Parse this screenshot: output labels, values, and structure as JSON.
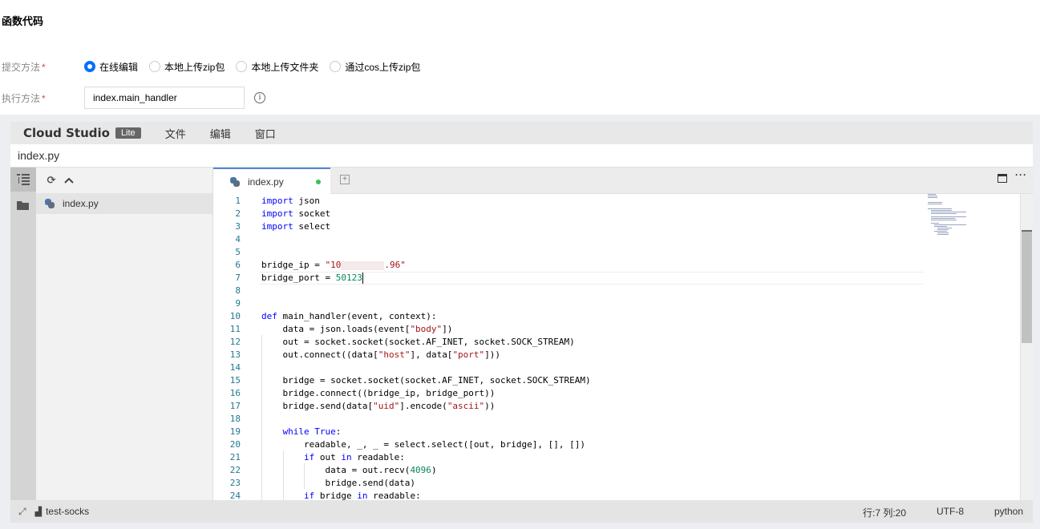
{
  "section_title": "函数代码",
  "submit_method": {
    "label": "提交方法",
    "required_mark": "*",
    "options": [
      {
        "label": "在线编辑",
        "checked": true
      },
      {
        "label": "本地上传zip包",
        "checked": false
      },
      {
        "label": "本地上传文件夹",
        "checked": false
      },
      {
        "label": "通过cos上传zip包",
        "checked": false
      }
    ]
  },
  "exec_method": {
    "label": "执行方法",
    "required_mark": "*",
    "value": "index.main_handler",
    "info_icon": "info-icon"
  },
  "ide": {
    "logo": "Cloud Studio",
    "badge": "Lite",
    "menu": [
      "文件",
      "编辑",
      "窗口"
    ],
    "open_file_title": "index.py",
    "explorer": {
      "icons": [
        "refresh-icon",
        "collapse-icon"
      ],
      "files": [
        "index.py"
      ]
    },
    "tab": {
      "label": "index.py",
      "modified": true
    },
    "code_lines": [
      {
        "n": "1",
        "text": "import json"
      },
      {
        "n": "2",
        "text": "import socket"
      },
      {
        "n": "3",
        "text": "import select"
      },
      {
        "n": "4",
        "text": ""
      },
      {
        "n": "5",
        "text": ""
      },
      {
        "n": "6",
        "text": "bridge_ip = \"10          .96\""
      },
      {
        "n": "7",
        "text": "bridge_port = 50123"
      },
      {
        "n": "8",
        "text": ""
      },
      {
        "n": "9",
        "text": ""
      },
      {
        "n": "10",
        "text": "def main_handler(event, context):"
      },
      {
        "n": "11",
        "text": "    data = json.loads(event[\"body\"])"
      },
      {
        "n": "12",
        "text": "    out = socket.socket(socket.AF_INET, socket.SOCK_STREAM)"
      },
      {
        "n": "13",
        "text": "    out.connect((data[\"host\"], data[\"port\"]))"
      },
      {
        "n": "14",
        "text": ""
      },
      {
        "n": "15",
        "text": "    bridge = socket.socket(socket.AF_INET, socket.SOCK_STREAM)"
      },
      {
        "n": "16",
        "text": "    bridge.connect((bridge_ip, bridge_port))"
      },
      {
        "n": "17",
        "text": "    bridge.send(data[\"uid\"].encode(\"ascii\"))"
      },
      {
        "n": "18",
        "text": ""
      },
      {
        "n": "19",
        "text": "    while True:"
      },
      {
        "n": "20",
        "text": "        readable, _, _ = select.select([out, bridge], [], [])"
      },
      {
        "n": "21",
        "text": "        if out in readable:"
      },
      {
        "n": "22",
        "text": "            data = out.recv(4096)"
      },
      {
        "n": "23",
        "text": "            bridge.send(data)"
      },
      {
        "n": "24",
        "text": "        if bridge in readable:"
      }
    ],
    "status": {
      "project": "test-socks",
      "position": "行:7 列:20",
      "encoding": "UTF-8",
      "language": "python"
    },
    "accent_color": "#006eff"
  }
}
